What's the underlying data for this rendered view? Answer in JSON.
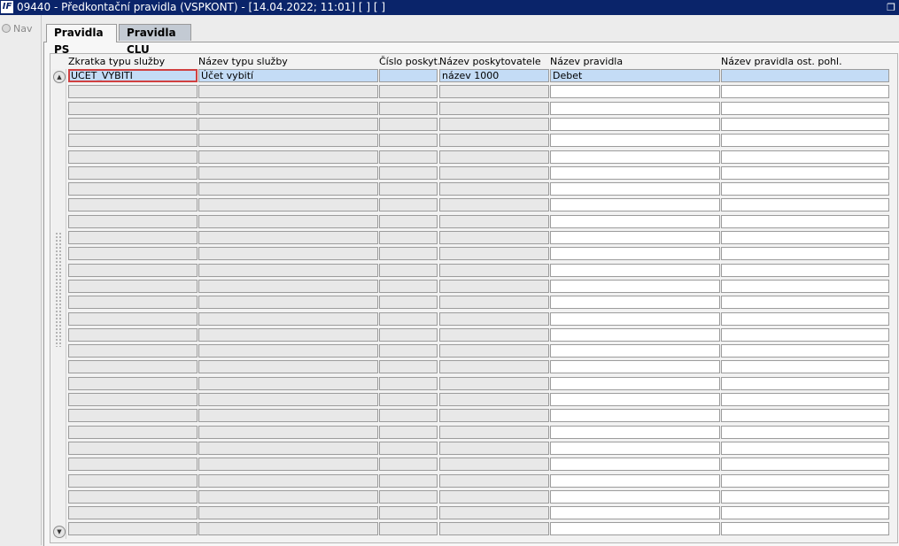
{
  "window": {
    "logo_text": "IF",
    "title": "09440 - Předkontační pravidla (VSPKONT) - [14.04.2022; 11:01]  [ ]  [ ]",
    "restore_icon": "restore-icon"
  },
  "left_panel": {
    "nav_label": "Nav"
  },
  "tabs": [
    {
      "label": "Pravidla PS",
      "active": true
    },
    {
      "label": "Pravidla CLU",
      "active": false
    }
  ],
  "table": {
    "columns": [
      "Zkratka typu služby",
      "Název typu služby",
      "Číslo poskyt.",
      "Název poskytovatele",
      "Název pravidla",
      "Název pravidla ost. pohl."
    ],
    "rows": [
      [
        "UCET_VYBITI",
        "Účet vybití",
        "",
        "název 1000",
        "Debet",
        ""
      ]
    ],
    "visible_row_count": 29
  },
  "colors": {
    "titlebar": "#0a246a",
    "selected_row": "#c4dcf6",
    "focus_border": "#d04040",
    "inactive_tab": "#c3cad3"
  }
}
